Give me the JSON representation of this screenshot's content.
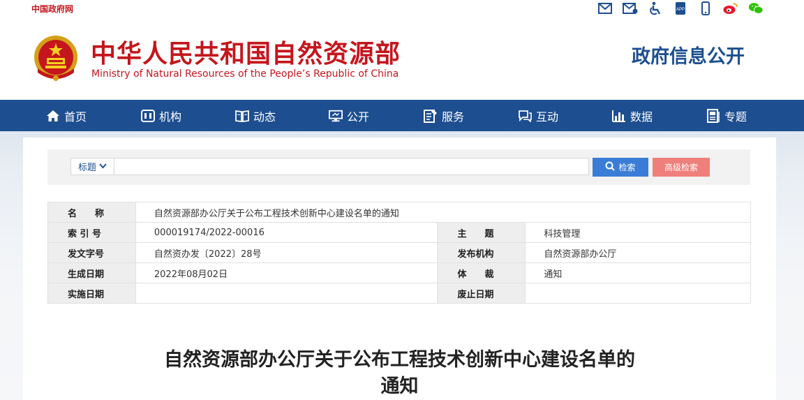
{
  "topbar": {
    "gov_link": "中国政府网",
    "icons": [
      "mail-icon",
      "mail-forward-icon",
      "accessibility-icon",
      "app-icon",
      "mobile-icon",
      "weibo-icon",
      "wechat-icon"
    ]
  },
  "header": {
    "title_cn": "中华人民共和国自然资源部",
    "title_en": "Ministry of Natural Resources of the People’s Republic of China",
    "section": "政府信息公开"
  },
  "nav": {
    "items": [
      {
        "label": "首页",
        "icon": "home-icon"
      },
      {
        "label": "机构",
        "icon": "institution-icon"
      },
      {
        "label": "动态",
        "icon": "news-icon"
      },
      {
        "label": "公开",
        "icon": "disclosure-icon"
      },
      {
        "label": "服务",
        "icon": "service-icon"
      },
      {
        "label": "互动",
        "icon": "interaction-icon"
      },
      {
        "label": "数据",
        "icon": "data-chart-icon"
      },
      {
        "label": "专题",
        "icon": "topic-icon"
      }
    ]
  },
  "search": {
    "type_label": "标题",
    "placeholder": "",
    "search_button": "检索",
    "advanced_button": "高级检索"
  },
  "meta": {
    "name_label": "名　　称",
    "name_value": "自然资源部办公厅关于公布工程技术创新中心建设名单的通知",
    "index_label": "索 引 号",
    "index_value": "000019174/2022-00016",
    "subject_label": "主　　题",
    "subject_value": "科技管理",
    "docno_label": "发文字号",
    "docno_value": "自然资办发〔2022〕28号",
    "issuer_label": "发布机构",
    "issuer_value": "自然资源部办公厅",
    "created_label": "生成日期",
    "created_value": "2022年08月02日",
    "genre_label": "体　　裁",
    "genre_value": "通知",
    "effective_label": "实施日期",
    "effective_value": "",
    "expired_label": "废止日期",
    "expired_value": ""
  },
  "document": {
    "title_line1": "自然资源部办公厅关于公布工程技术创新中心建设名单的",
    "title_line2": "通知"
  },
  "colors": {
    "brand_red": "#c4161c",
    "nav_blue": "#1d4e90",
    "search_blue": "#3a7dd6",
    "advanced_pink": "#ef7f7a"
  }
}
